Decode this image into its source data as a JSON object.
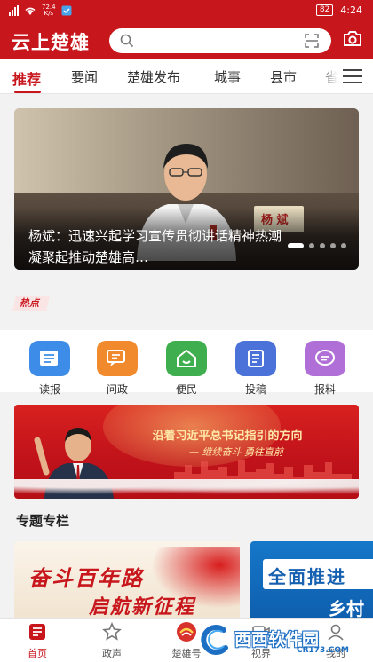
{
  "status": {
    "speed": "72.4",
    "speed_unit": "K/s",
    "battery": "82",
    "time": "4:24"
  },
  "header": {
    "logo": "云上楚雄"
  },
  "tabs": [
    {
      "label": "推荐",
      "active": true
    },
    {
      "label": "要闻"
    },
    {
      "label": "楚雄发布"
    },
    {
      "label": "城事"
    },
    {
      "label": "县市"
    },
    {
      "label": "省"
    }
  ],
  "banner": {
    "caption": "杨斌：迅速兴起学习宣传贯彻讲话精神热潮 凝聚起推动楚雄高…",
    "nameplate": "杨 斌",
    "slide_index": 1,
    "slide_count": 5
  },
  "hot": {
    "label": "热点"
  },
  "services": [
    {
      "label": "读报",
      "icon": "newspaper-icon",
      "color": "#3d8ce8"
    },
    {
      "label": "问政",
      "icon": "chat-question-icon",
      "color": "#f08a2c"
    },
    {
      "label": "便民",
      "icon": "home-icon",
      "color": "#3fae4e"
    },
    {
      "label": "投稿",
      "icon": "document-submit-icon",
      "color": "#4a72d8"
    },
    {
      "label": "报料",
      "icon": "message-icon",
      "color": "#b06fd6"
    }
  ],
  "promo": {
    "headline": "沿着习近平总书记指引的方向",
    "subline": "— 继续奋斗  勇往直前"
  },
  "section": {
    "title": "专题专栏"
  },
  "topics": [
    {
      "line1": "奋斗百年路",
      "line2": "启航新征程"
    },
    {
      "line1": "全面推进",
      "line2": "乡村"
    }
  ],
  "bottom_nav": [
    {
      "label": "首页",
      "icon": "home-page-icon",
      "active": true
    },
    {
      "label": "政声",
      "icon": "star-badge-icon"
    },
    {
      "label": "楚雄号",
      "icon": "chuxiong-hao-icon"
    },
    {
      "label": "视界",
      "icon": "video-icon"
    },
    {
      "label": "我的",
      "icon": "profile-icon"
    }
  ],
  "watermark": {
    "brand": "西西软件园",
    "site": "CR173.COM"
  },
  "colors": {
    "primary": "#c8161d",
    "background": "#f2f2f2"
  }
}
